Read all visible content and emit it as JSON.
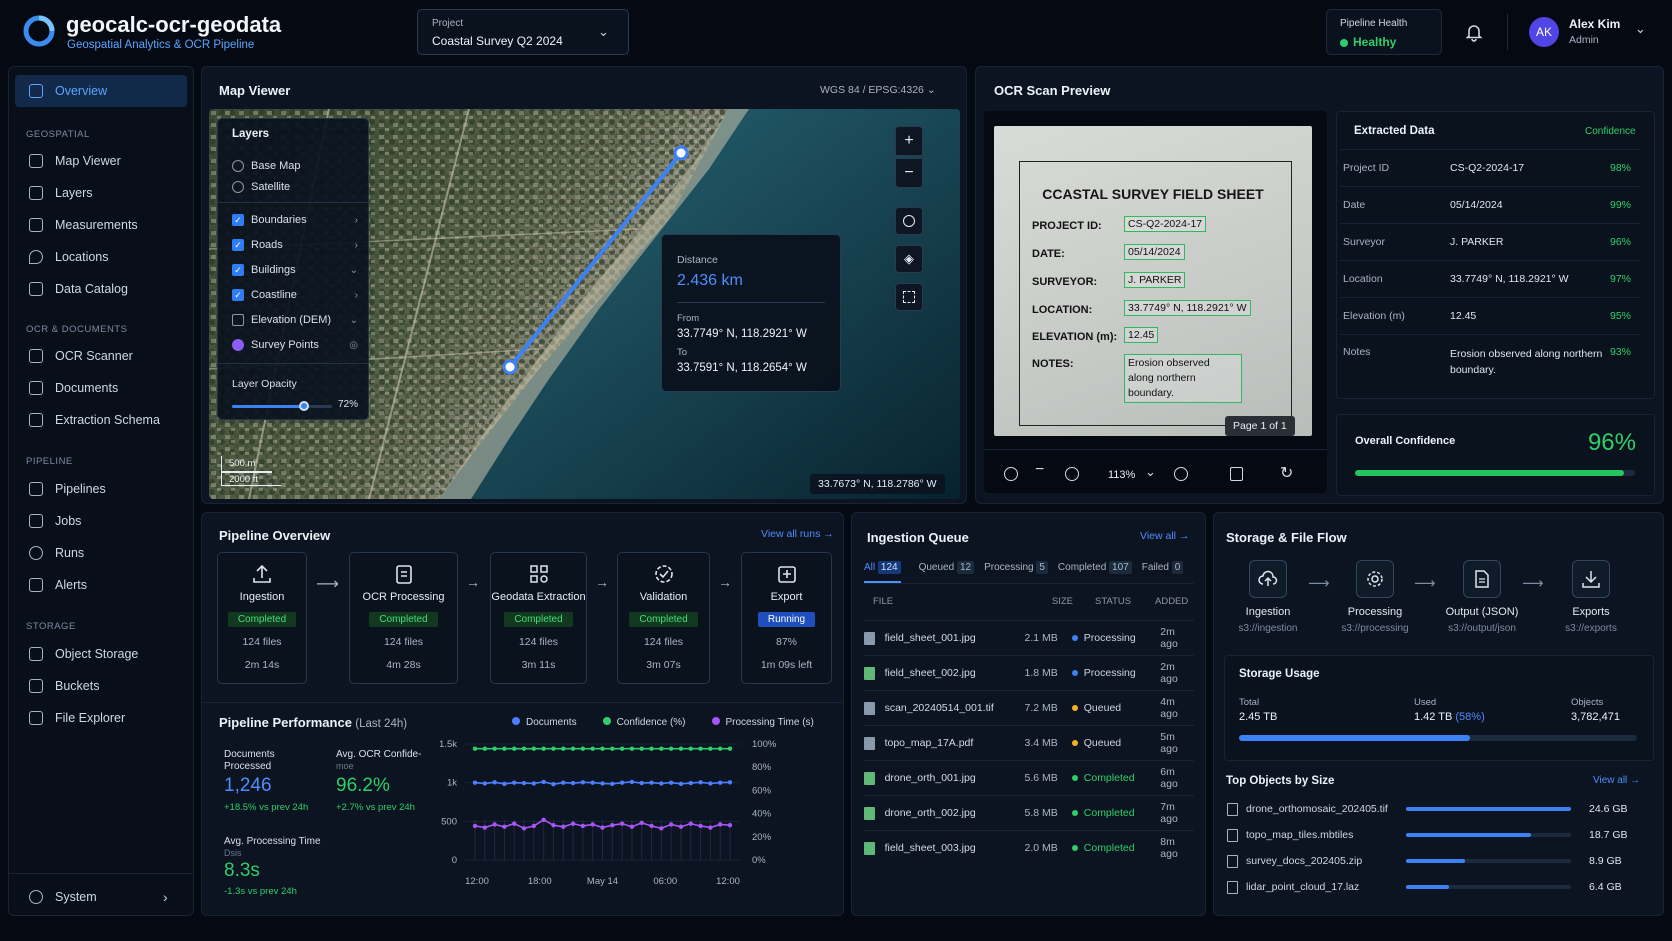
{
  "app": {
    "name": "geocalc-ocr-geodata",
    "subtitle": "Geospatial Analytics & OCR Pipeline"
  },
  "project": {
    "label": "Project",
    "value": "Coastal Survey Q2 2024"
  },
  "health": {
    "label": "Pipeline Health",
    "value": "Healthy"
  },
  "user": {
    "initials": "AK",
    "name": "Alex Kim",
    "role": "Admin"
  },
  "nav": {
    "overview": "Overview",
    "sections": [
      {
        "title": "GEOSPATIAL",
        "items": [
          "Map Viewer",
          "Layers",
          "Measurements",
          "Locations",
          "Data Catalog"
        ]
      },
      {
        "title": "OCR & DOCUMENTS",
        "items": [
          "OCR Scanner",
          "Documents",
          "Extraction Schema"
        ]
      },
      {
        "title": "PIPELINE",
        "items": [
          "Pipelines",
          "Jobs",
          "Runs",
          "Alerts"
        ]
      },
      {
        "title": "STORAGE",
        "items": [
          "Object Storage",
          "Buckets",
          "File Explorer"
        ]
      }
    ],
    "system": "System"
  },
  "map": {
    "title": "Map Viewer",
    "crs": "WGS 84 / EPSG:4326",
    "layers_title": "Layers",
    "base": [
      "Base Map",
      "Satellite"
    ],
    "layers": [
      {
        "name": "Boundaries",
        "checked": true
      },
      {
        "name": "Roads",
        "checked": true
      },
      {
        "name": "Buildings",
        "checked": true
      },
      {
        "name": "Coastline",
        "checked": true
      },
      {
        "name": "Elevation (DEM)",
        "checked": false
      },
      {
        "name": "Survey Points",
        "checked": true
      }
    ],
    "opacity_label": "Layer Opacity",
    "opacity": "72%",
    "opacity_value": 0.72,
    "scale_m": "500 m",
    "scale_ft": "2000 ft",
    "cursor": "33.7673° N, 118.2786° W",
    "distance_label": "Distance",
    "distance": "2.436 km",
    "from_label": "From",
    "from": "33.7749° N, 118.2921° W",
    "to_label": "To",
    "to": "33.7591° N, 118.2654° W"
  },
  "ocr": {
    "title": "OCR Scan Preview",
    "sheet_title": "CCASTAL SURVEY FIELD SHEET",
    "fields": [
      {
        "k": "PROJECT ID:",
        "v": "CS-Q2-2024-17"
      },
      {
        "k": "DATE:",
        "v": "05/14/2024"
      },
      {
        "k": "SURVEYOR:",
        "v": "J. PARKER"
      },
      {
        "k": "LOCATION:",
        "v": "33.7749° N, 118.2921° W"
      },
      {
        "k": "ELEVATION (m):",
        "v": "12.45"
      },
      {
        "k": "NOTES:",
        "v": "Erosion observed along northern boundary."
      }
    ],
    "page": "Page 1 of 1",
    "zoom": "113%"
  },
  "extracted": {
    "title": "Extracted Data",
    "confidence_label": "Confidence",
    "rows": [
      {
        "k": "Project ID",
        "v": "CS-Q2-2024-17",
        "c": "98%"
      },
      {
        "k": "Date",
        "v": "05/14/2024",
        "c": "99%"
      },
      {
        "k": "Surveyor",
        "v": "J. PARKER",
        "c": "96%"
      },
      {
        "k": "Location",
        "v": "33.7749° N, 118.2921° W",
        "c": "97%"
      },
      {
        "k": "Elevation (m)",
        "v": "12.45",
        "c": "95%"
      },
      {
        "k": "Notes",
        "v": "Erosion observed along northern boundary.",
        "c": "93%"
      }
    ],
    "overall_label": "Overall Confidence",
    "overall": "96%",
    "overall_value": 0.96
  },
  "pipeline": {
    "title": "Pipeline Overview",
    "view_all": "View all runs →",
    "stages": [
      {
        "name": "Ingestion",
        "status": "Completed",
        "files": "124 files",
        "time": "2m 14s"
      },
      {
        "name": "OCR Processing",
        "status": "Completed",
        "files": "124 files",
        "time": "4m 28s"
      },
      {
        "name": "Geodata Extraction",
        "status": "Completed",
        "files": "124 files",
        "time": "3m 11s"
      },
      {
        "name": "Validation",
        "status": "Completed",
        "files": "124 files",
        "time": "3m 07s"
      },
      {
        "name": "Export",
        "status": "Running",
        "files": "87%",
        "time": "1m 09s left"
      }
    ]
  },
  "perf": {
    "title": "Pipeline Performance",
    "period": "(Last 24h)",
    "legend": [
      "Documents",
      "Confidence (%)",
      "Processing Time (s)"
    ],
    "docs_label": "Documents Processed",
    "docs": "1,246",
    "docs_delta": "+18.5% vs prev 24h",
    "conf_label": "Avg. OCR Confide-",
    "conf_sub": "moe",
    "conf": "96.2%",
    "conf_delta": "+2.7% vs prev 24h",
    "time_label": "Avg. Processing Time",
    "time_sub": "Dsis",
    "time": "8.3s",
    "time_delta": "-1.3s vs prev 24h"
  },
  "chart_data": {
    "type": "line",
    "x": [
      "12:00",
      "18:00",
      "May 14",
      "06:00",
      "12:00"
    ],
    "y_left_ticks": [
      "1.5k",
      "1k",
      "500",
      "0"
    ],
    "y_right_ticks": [
      "100%",
      "80%",
      "60%",
      "40%",
      "20%",
      "0%"
    ],
    "series": [
      {
        "name": "Confidence (%)",
        "color": "#2ecf6a",
        "values": [
          96,
          96,
          96,
          96,
          96,
          96,
          96,
          96,
          96,
          96,
          96,
          96,
          96,
          96,
          96,
          96,
          96,
          96,
          96,
          96,
          96,
          96,
          96,
          96,
          96,
          96,
          96
        ]
      },
      {
        "name": "Documents",
        "color": "#4f7dff",
        "values": [
          1000,
          990,
          1005,
          985,
          1000,
          995,
          990,
          1010,
          980,
          1000,
          995,
          1005,
          1000,
          990,
          985,
          1000,
          1010,
          995,
          1000,
          990,
          1000,
          985,
          995,
          1005,
          990,
          1000,
          1005
        ]
      },
      {
        "name": "Processing Time (s)",
        "color": "#a855f7",
        "values": [
          440,
          420,
          460,
          430,
          470,
          410,
          440,
          520,
          450,
          430,
          470,
          440,
          460,
          420,
          450,
          470,
          430,
          480,
          440,
          410,
          460,
          430,
          470,
          440,
          420,
          460,
          450
        ]
      }
    ]
  },
  "queue": {
    "title": "Ingestion Queue",
    "view_all": "View all →",
    "tabs": [
      {
        "l": "All",
        "n": "124"
      },
      {
        "l": "Queued",
        "n": "12"
      },
      {
        "l": "Processing",
        "n": "5"
      },
      {
        "l": "Completed",
        "n": "107"
      },
      {
        "l": "Failed",
        "n": "0"
      }
    ],
    "cols": [
      "FILE",
      "SIZE",
      "STATUS",
      "ADDED"
    ],
    "rows": [
      {
        "f": "field_sheet_001.jpg",
        "s": "2.1 MB",
        "st": "Processing",
        "a": "2m ago",
        "c": "#3b82f6"
      },
      {
        "f": "field_sheet_002.jpg",
        "s": "1.8 MB",
        "st": "Processing",
        "a": "2m ago",
        "c": "#3b82f6"
      },
      {
        "f": "scan_20240514_001.tif",
        "s": "7.2 MB",
        "st": "Queued",
        "a": "4m ago",
        "c": "#f5b21e"
      },
      {
        "f": "topo_map_17A.pdf",
        "s": "3.4 MB",
        "st": "Queued",
        "a": "5m ago",
        "c": "#f5b21e"
      },
      {
        "f": "drone_orth_001.jpg",
        "s": "5.6 MB",
        "st": "Completed",
        "a": "6m ago",
        "c": "#2ecf6a"
      },
      {
        "f": "drone_orth_002.jpg",
        "s": "5.8 MB",
        "st": "Completed",
        "a": "7m ago",
        "c": "#2ecf6a"
      },
      {
        "f": "field_sheet_003.jpg",
        "s": "2.0 MB",
        "st": "Completed",
        "a": "8m ago",
        "c": "#2ecf6a"
      }
    ]
  },
  "storage": {
    "title": "Storage & File Flow",
    "flow": [
      {
        "l": "Ingestion",
        "p": "s3://ingestion"
      },
      {
        "l": "Processing",
        "p": "s3://processing"
      },
      {
        "l": "Output (JSON)",
        "p": "s3://output/json"
      },
      {
        "l": "Exports",
        "p": "s3://exports"
      }
    ],
    "usage_title": "Storage Usage",
    "total_label": "Total",
    "total": "2.45 TB",
    "used_label": "Used",
    "used": "1.42 TB",
    "used_pct": "(58%)",
    "used_value": 0.58,
    "objects_label": "Objects",
    "objects": "3,782,471",
    "top_title": "Top Objects by Size",
    "top_view_all": "View all →",
    "top": [
      {
        "n": "drone_orthomosaic_202405.tif",
        "s": "24.6 GB",
        "f": 1.0
      },
      {
        "n": "topo_map_tiles.mbtiles",
        "s": "18.7 GB",
        "f": 0.76
      },
      {
        "n": "survey_docs_202405.zip",
        "s": "8.9 GB",
        "f": 0.36
      },
      {
        "n": "lidar_point_cloud_17.laz",
        "s": "6.4 GB",
        "f": 0.26
      }
    ]
  }
}
